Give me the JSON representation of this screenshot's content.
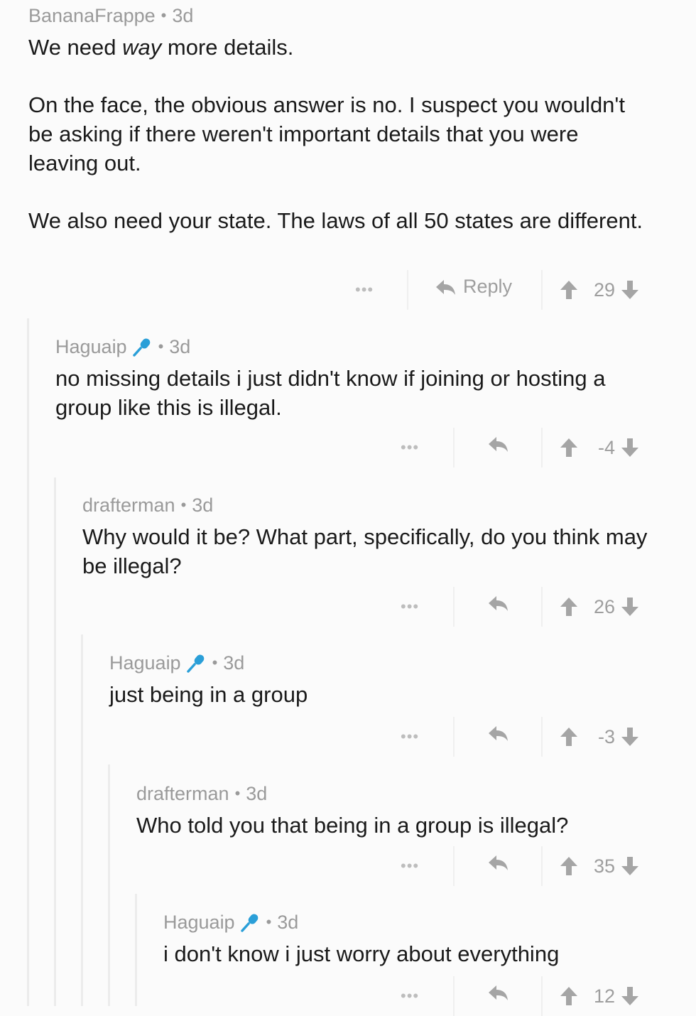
{
  "comments": [
    {
      "author": "BananaFrappe",
      "age": "3d",
      "flair": false,
      "paragraphs": [
        "We need way more details.",
        "On the face, the obvious answer is no. I suspect you wouldn't be asking if there weren't important details that you were leaving out.",
        "We also need your state. The laws of all 50 states are different."
      ],
      "first_pre": "We need ",
      "first_em": "way",
      "first_post": " more details.",
      "more": "•••",
      "reply_label": "Reply",
      "score": "29"
    },
    {
      "author": "Haguaip",
      "age": "3d",
      "flair": true,
      "text": "no missing details i just didn't know if joining or hosting a group like this is illegal.",
      "more": "•••",
      "score": "-4"
    },
    {
      "author": "drafterman",
      "age": "3d",
      "flair": false,
      "text": "Why would it be? What part, specifically, do you think may be illegal?",
      "more": "•••",
      "score": "26"
    },
    {
      "author": "Haguaip",
      "age": "3d",
      "flair": true,
      "text": "just being in a group",
      "more": "•••",
      "score": "-3"
    },
    {
      "author": "drafterman",
      "age": "3d",
      "flair": false,
      "text": "Who told you that being in a group is illegal?",
      "more": "•••",
      "score": "35"
    },
    {
      "author": "Haguaip",
      "age": "3d",
      "flair": true,
      "text": "i don't know i just worry about everything",
      "more": "•••",
      "score": "12"
    }
  ],
  "colors": {
    "background": "#fbfbfb",
    "meta_text": "#9a9a9a",
    "body_text": "#1a1a1a",
    "flair_icon": "#2a9fd8",
    "action_icon": "#a5a5a5"
  },
  "icons": {
    "flair": "microphone-icon",
    "reply": "reply-arrow-icon",
    "upvote": "upvote-arrow-icon",
    "downvote": "downvote-arrow-icon",
    "more": "more-options-icon"
  }
}
